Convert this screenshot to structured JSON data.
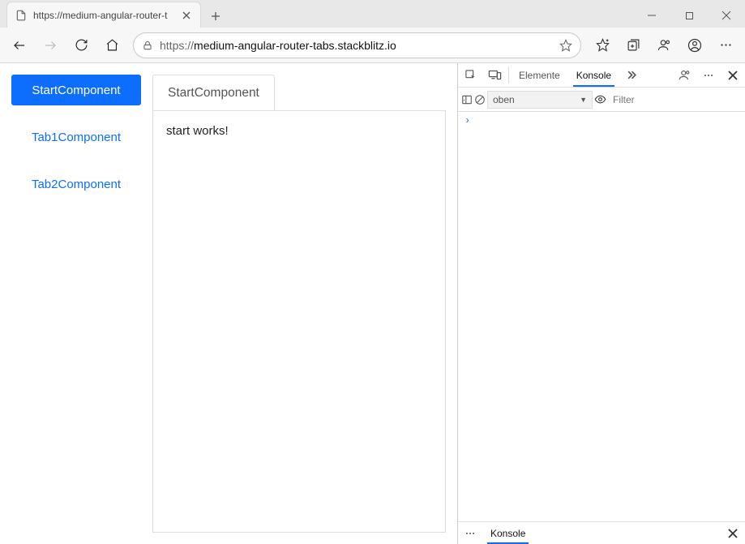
{
  "browser": {
    "tab_title": "https://medium-angular-router-t",
    "url_prefix": "https://",
    "url_host": "medium-angular-router-tabs.stackblitz.io",
    "filter_placeholder": "Filter"
  },
  "nav": {
    "items": [
      {
        "label": "StartComponent",
        "active": true
      },
      {
        "label": "Tab1Component",
        "active": false
      },
      {
        "label": "Tab2Component",
        "active": false
      }
    ]
  },
  "content": {
    "tab_label": "StartComponent",
    "body_text": "start works!"
  },
  "devtools": {
    "tabs": [
      {
        "label": "Elemente",
        "active": false
      },
      {
        "label": "Konsole",
        "active": true
      }
    ],
    "context_selector": "oben",
    "prompt": "›",
    "drawer_tab": "Konsole"
  }
}
